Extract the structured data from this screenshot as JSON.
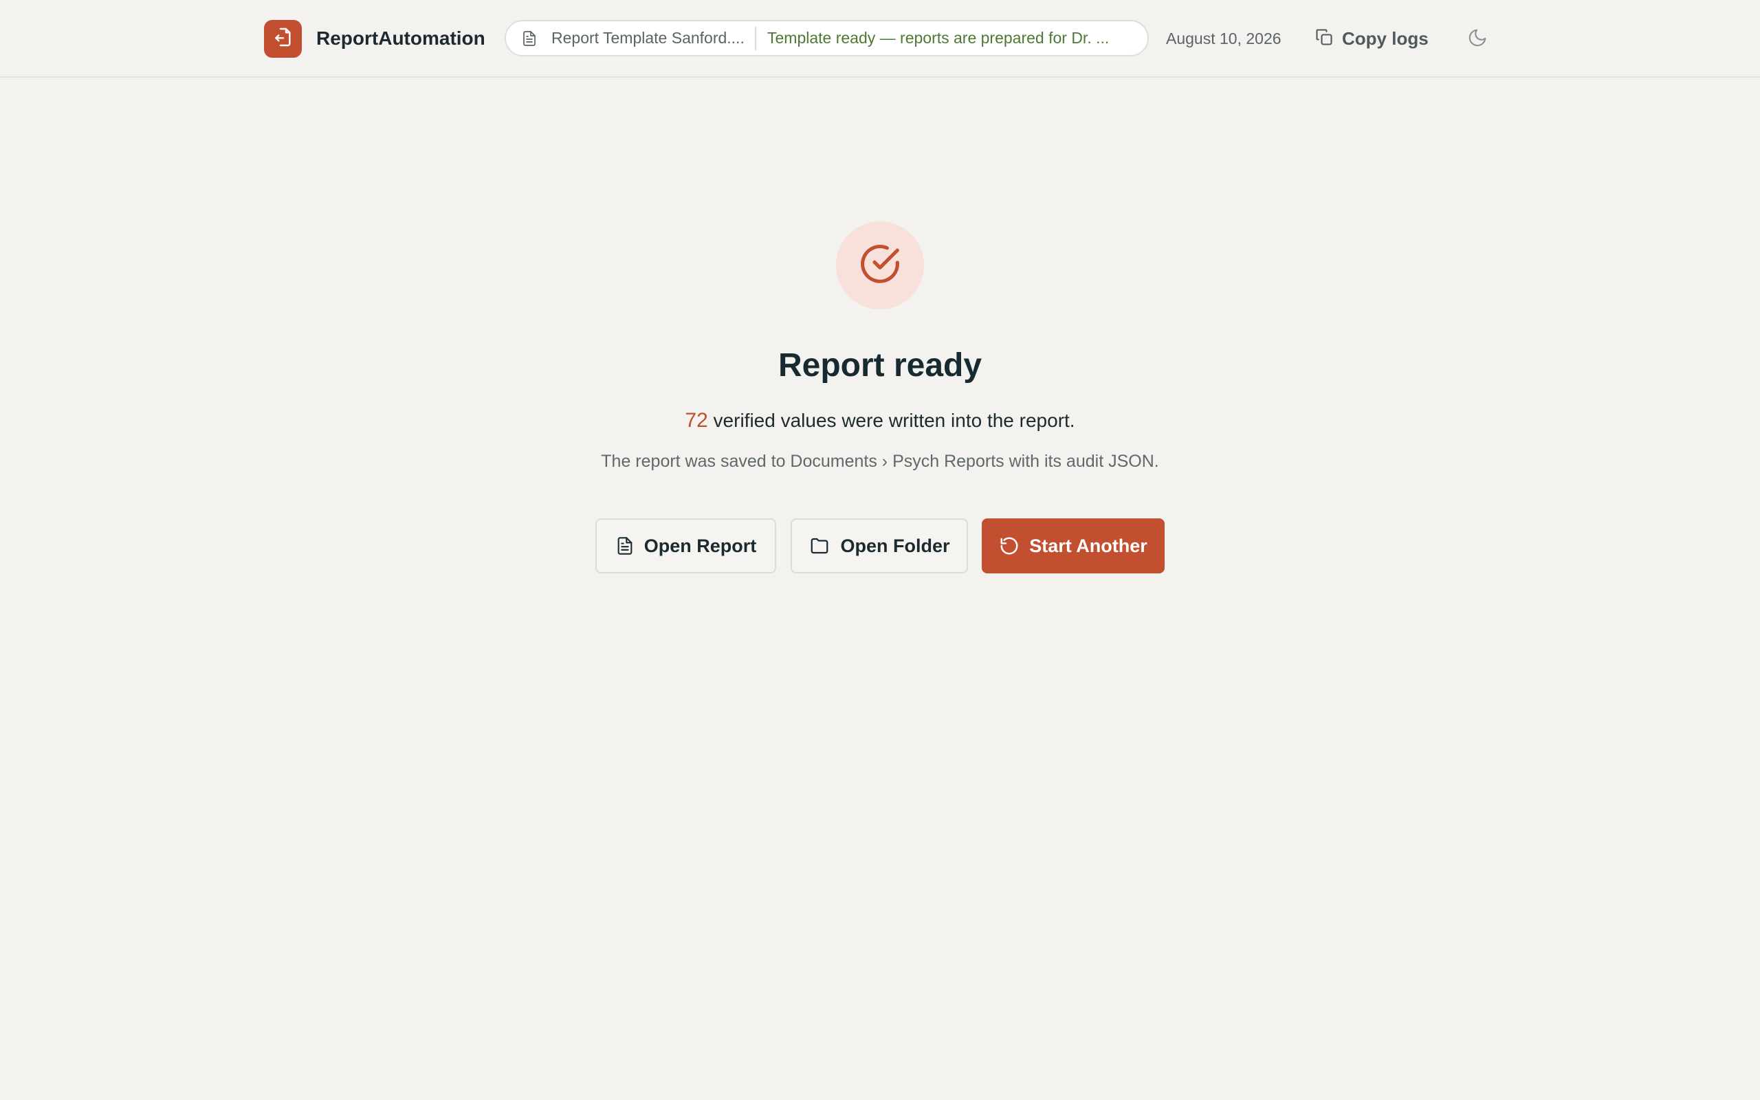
{
  "header": {
    "app_name": "ReportAutomation",
    "logo_icon": "document-export-icon",
    "template_name": "Report Template Sanford....",
    "template_status": "Template ready — reports are prepared for Dr. ...",
    "date": "August 10, 2026",
    "copy_logs_label": "Copy logs",
    "theme_toggle_icon": "moon-icon"
  },
  "result": {
    "icon": "check-circle-icon",
    "title": "Report ready",
    "verified_count": "72",
    "summary_suffix": " verified values were written into the report.",
    "saved_note": "The report was saved to Documents › Psych Reports with its audit JSON."
  },
  "actions": {
    "open_report": "Open Report",
    "open_folder": "Open Folder",
    "start_another": "Start Another"
  },
  "colors": {
    "accent": "#c24f2f",
    "status_green": "#4c7a33",
    "background": "#f3f2ee"
  }
}
